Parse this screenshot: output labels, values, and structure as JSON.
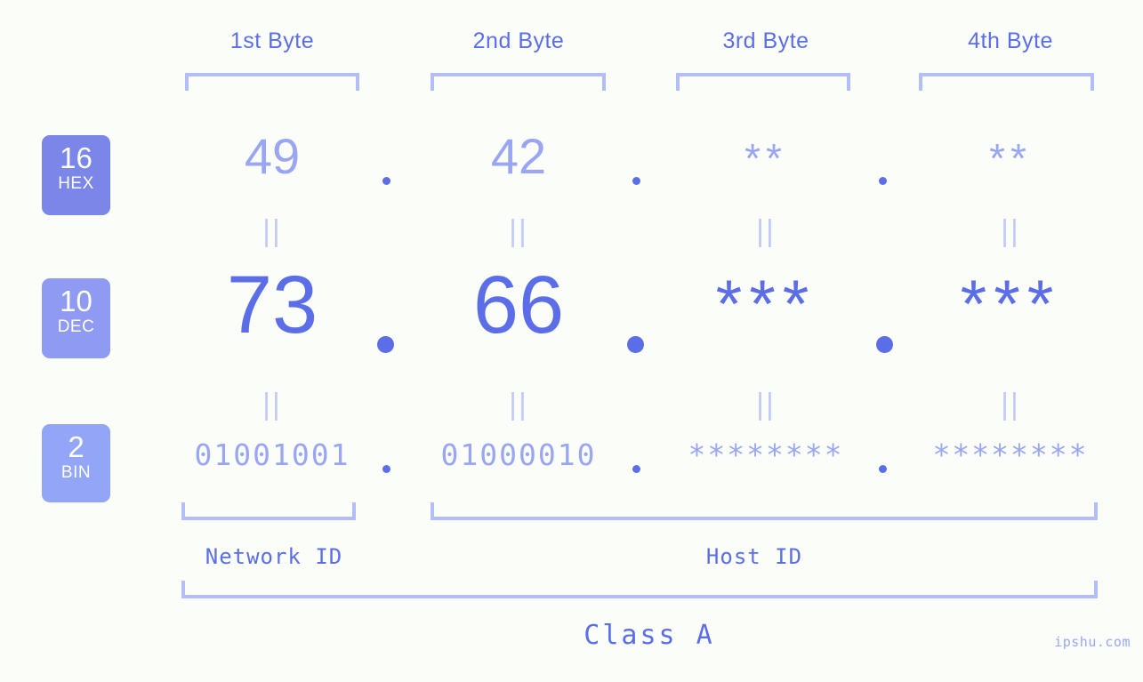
{
  "colors": {
    "background": "#fbfdf9",
    "accent_strong": "#5b6ee8",
    "accent_light": "#9aa6f2",
    "bracket": "#b3bdfa",
    "connector": "#c3caf8",
    "badge_hex": "#7b87e8",
    "badge_dec": "#8f9bf2",
    "badge_bin": "#92a5f7"
  },
  "byte_headers": [
    {
      "label": "1st Byte"
    },
    {
      "label": "2nd Byte"
    },
    {
      "label": "3rd Byte"
    },
    {
      "label": "4th Byte"
    }
  ],
  "bases": [
    {
      "number": "16",
      "name": "HEX"
    },
    {
      "number": "10",
      "name": "DEC"
    },
    {
      "number": "2",
      "name": "BIN"
    }
  ],
  "rows": {
    "hex": {
      "values": [
        "49",
        "42",
        "**",
        "**"
      ]
    },
    "dec": {
      "values": [
        "73",
        "66",
        "***",
        "***"
      ]
    },
    "bin": {
      "values": [
        "01001001",
        "01000010",
        "********",
        "********"
      ]
    }
  },
  "separators": {
    "dot": "."
  },
  "connectors": {
    "equals": "||"
  },
  "id_labels": [
    {
      "label": "Network ID"
    },
    {
      "label": "Host ID"
    }
  ],
  "class_label": "Class A",
  "watermark": "ipshu.com"
}
